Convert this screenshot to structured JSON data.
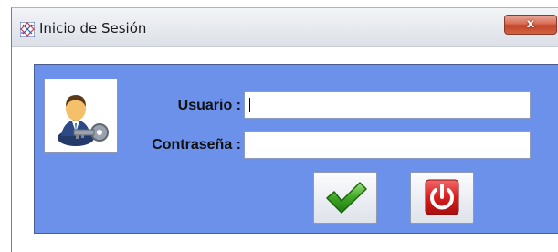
{
  "window": {
    "title": "Inicio de Sesión",
    "close_label": "x",
    "app_icon": "app-grid-icon"
  },
  "login": {
    "avatar_icon": "user-key-icon",
    "user_label": "Usuario :",
    "user_value": "",
    "password_label": "Contraseña :",
    "password_value": "",
    "accept_icon": "checkmark-icon",
    "exit_icon": "power-icon"
  },
  "colors": {
    "panel": "#6b91ea",
    "accept": "#3fa524",
    "exit": "#d81e1e"
  }
}
